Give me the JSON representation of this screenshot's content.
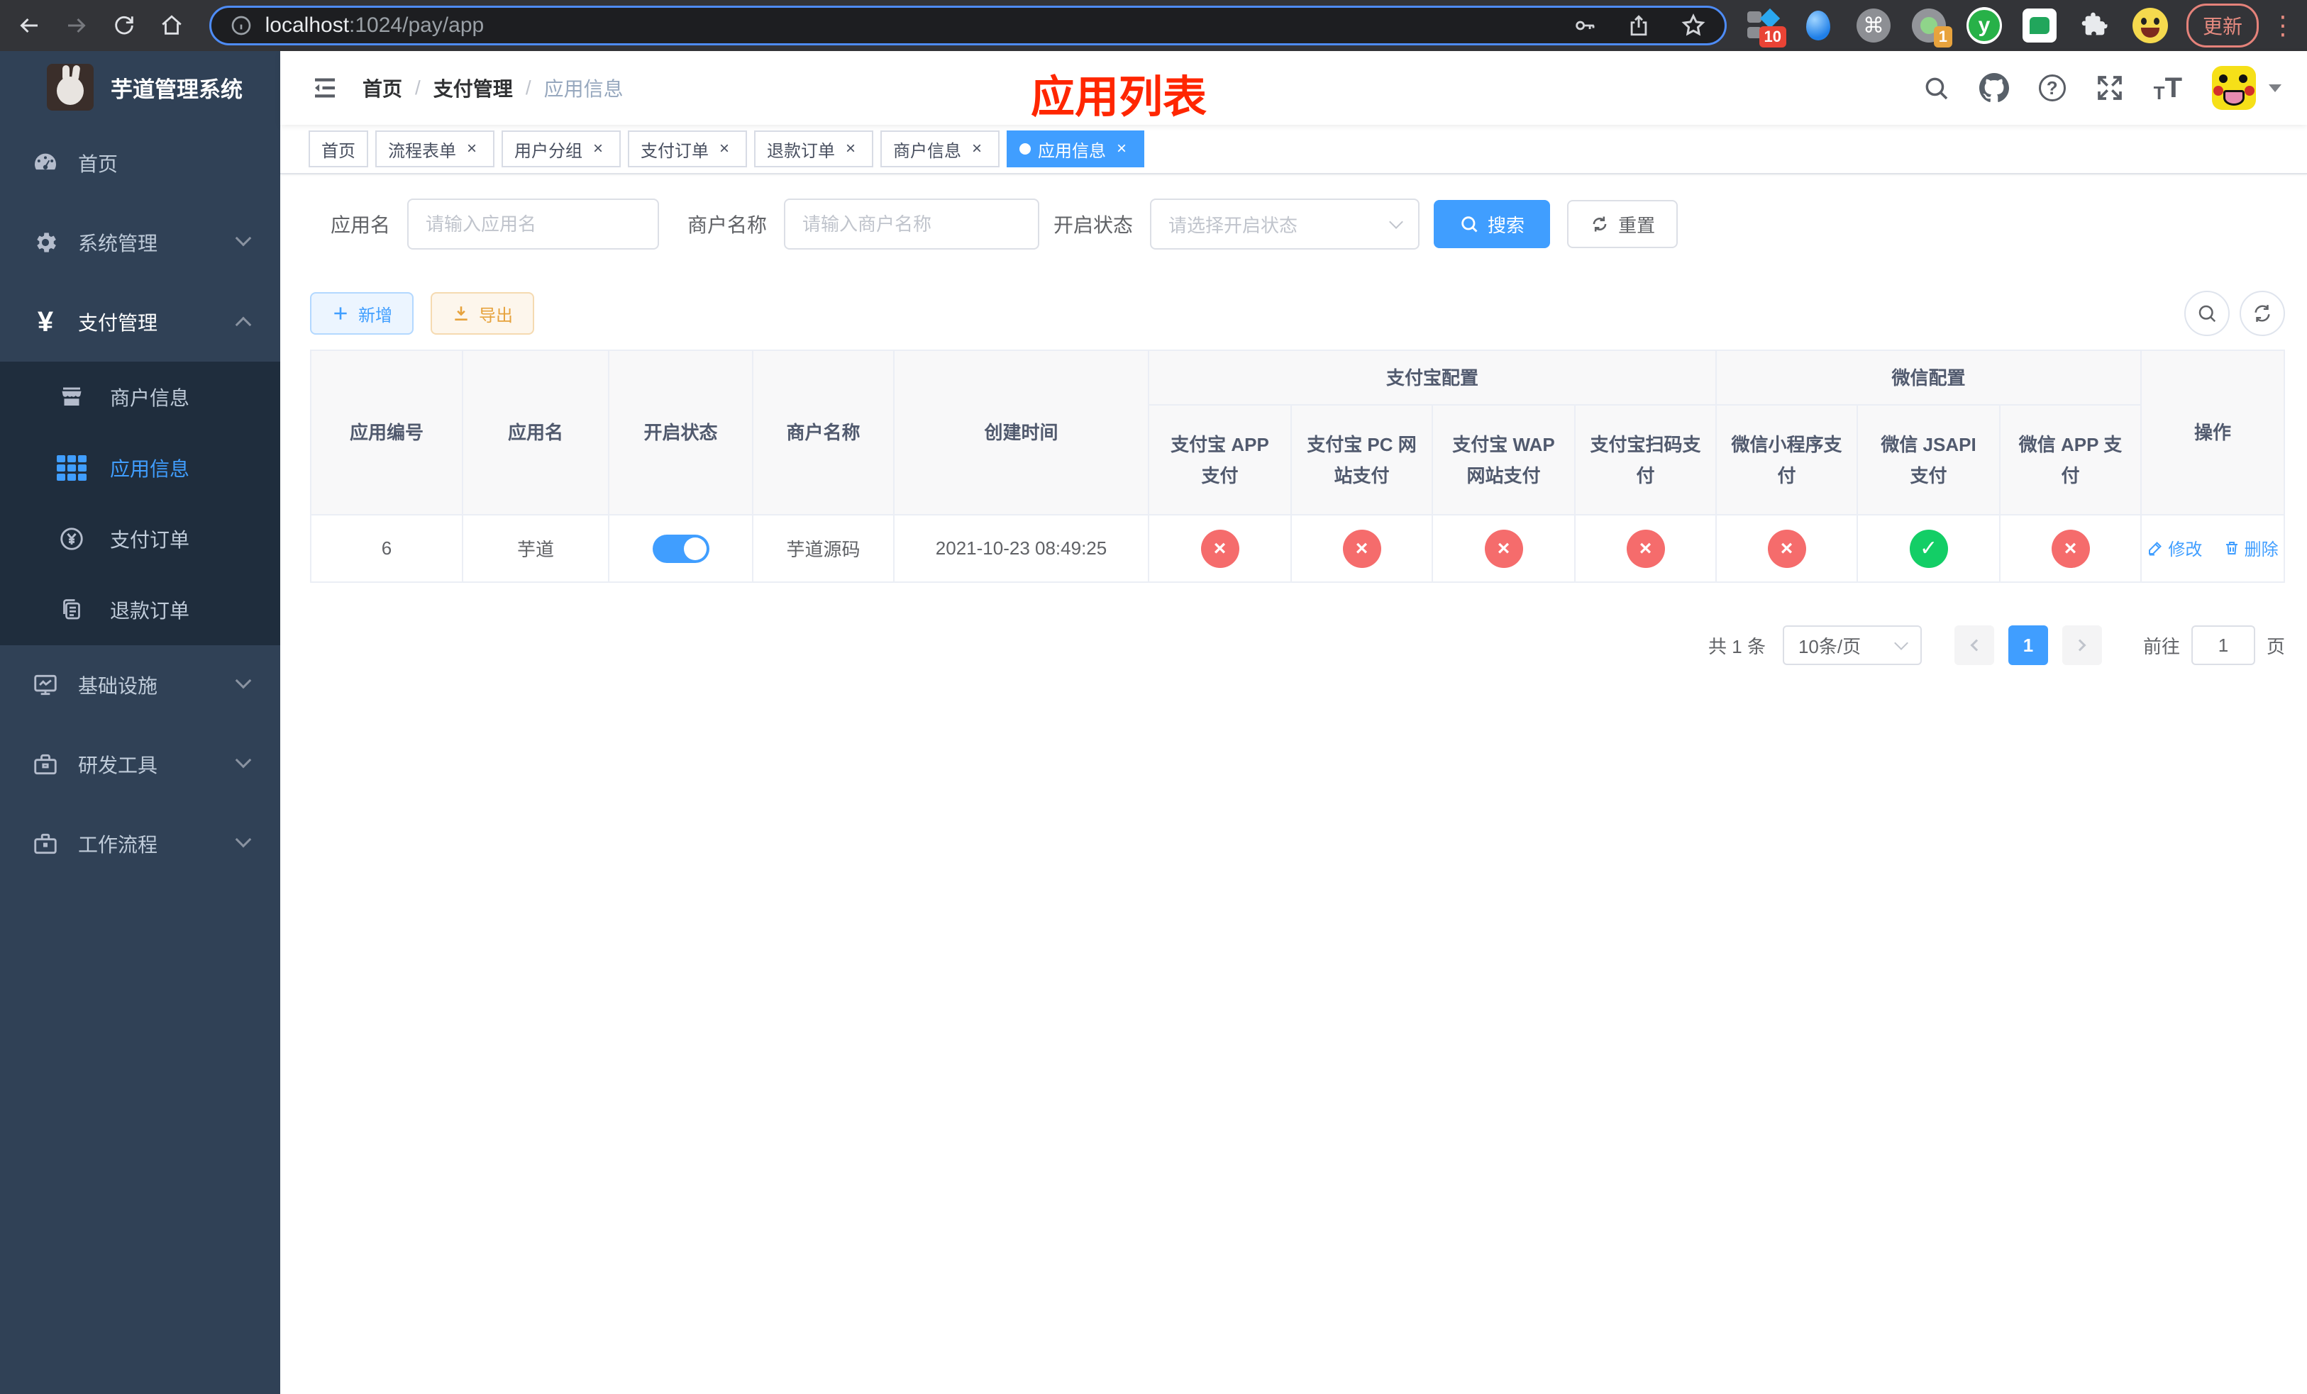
{
  "browser": {
    "url_host": "localhost",
    "url_path": ":1024/pay/app",
    "update_label": "更新",
    "ext_badge_sidebar": "10",
    "ext_badge_profile": "1",
    "ext_y_label": "y"
  },
  "annotation": {
    "title": "应用列表",
    "color": "#ff2600"
  },
  "sidebar": {
    "title": "芋道管理系统",
    "items": [
      {
        "label": "首页"
      },
      {
        "label": "系统管理"
      },
      {
        "label": "支付管理"
      },
      {
        "label": "基础设施"
      },
      {
        "label": "研发工具"
      },
      {
        "label": "工作流程"
      }
    ],
    "submenu": [
      {
        "label": "商户信息"
      },
      {
        "label": "应用信息"
      },
      {
        "label": "支付订单"
      },
      {
        "label": "退款订单"
      }
    ]
  },
  "navbar": {
    "breadcrumb": [
      "首页",
      "支付管理",
      "应用信息"
    ]
  },
  "tabs": [
    {
      "label": "首页",
      "closable": false,
      "active": false
    },
    {
      "label": "流程表单",
      "closable": true,
      "active": false
    },
    {
      "label": "用户分组",
      "closable": true,
      "active": false
    },
    {
      "label": "支付订单",
      "closable": true,
      "active": false
    },
    {
      "label": "退款订单",
      "closable": true,
      "active": false
    },
    {
      "label": "商户信息",
      "closable": true,
      "active": false
    },
    {
      "label": "应用信息",
      "closable": true,
      "active": true
    }
  ],
  "filters": {
    "app_name_label": "应用名",
    "app_name_placeholder": "请输入应用名",
    "merchant_label": "商户名称",
    "merchant_placeholder": "请输入商户名称",
    "status_label": "开启状态",
    "status_placeholder": "请选择开启状态",
    "search_label": "搜索",
    "reset_label": "重置"
  },
  "toolbar": {
    "add_label": "新增",
    "export_label": "导出"
  },
  "table": {
    "groups": {
      "alipay": "支付宝配置",
      "wechat": "微信配置"
    },
    "columns": [
      "应用编号",
      "应用名",
      "开启状态",
      "商户名称",
      "创建时间",
      "操作"
    ],
    "subcolumns": [
      "支付宝 APP 支付",
      "支付宝 PC 网站支付",
      "支付宝 WAP 网站支付",
      "支付宝扫码支付",
      "微信小程序支付",
      "微信 JSAPI 支付",
      "微信 APP 支付"
    ],
    "row": {
      "id": "6",
      "name": "芋道",
      "enabled": true,
      "merchant": "芋道源码",
      "created": "2021-10-23 08:49:25",
      "statuses": [
        "no",
        "no",
        "no",
        "no",
        "no",
        "yes",
        "no"
      ],
      "edit_label": "修改",
      "delete_label": "删除"
    }
  },
  "pagination": {
    "total": "共 1 条",
    "page_size": "10条/页",
    "current_page": "1",
    "goto_label": "前往",
    "goto_value": "1",
    "unit_label": "页"
  },
  "colors": {
    "primary": "#409eff",
    "success": "#13ce66",
    "danger": "#f56c6c",
    "warning": "#e6a23c",
    "sidebar_bg": "#304156",
    "submenu_bg": "#1f2d3d"
  }
}
